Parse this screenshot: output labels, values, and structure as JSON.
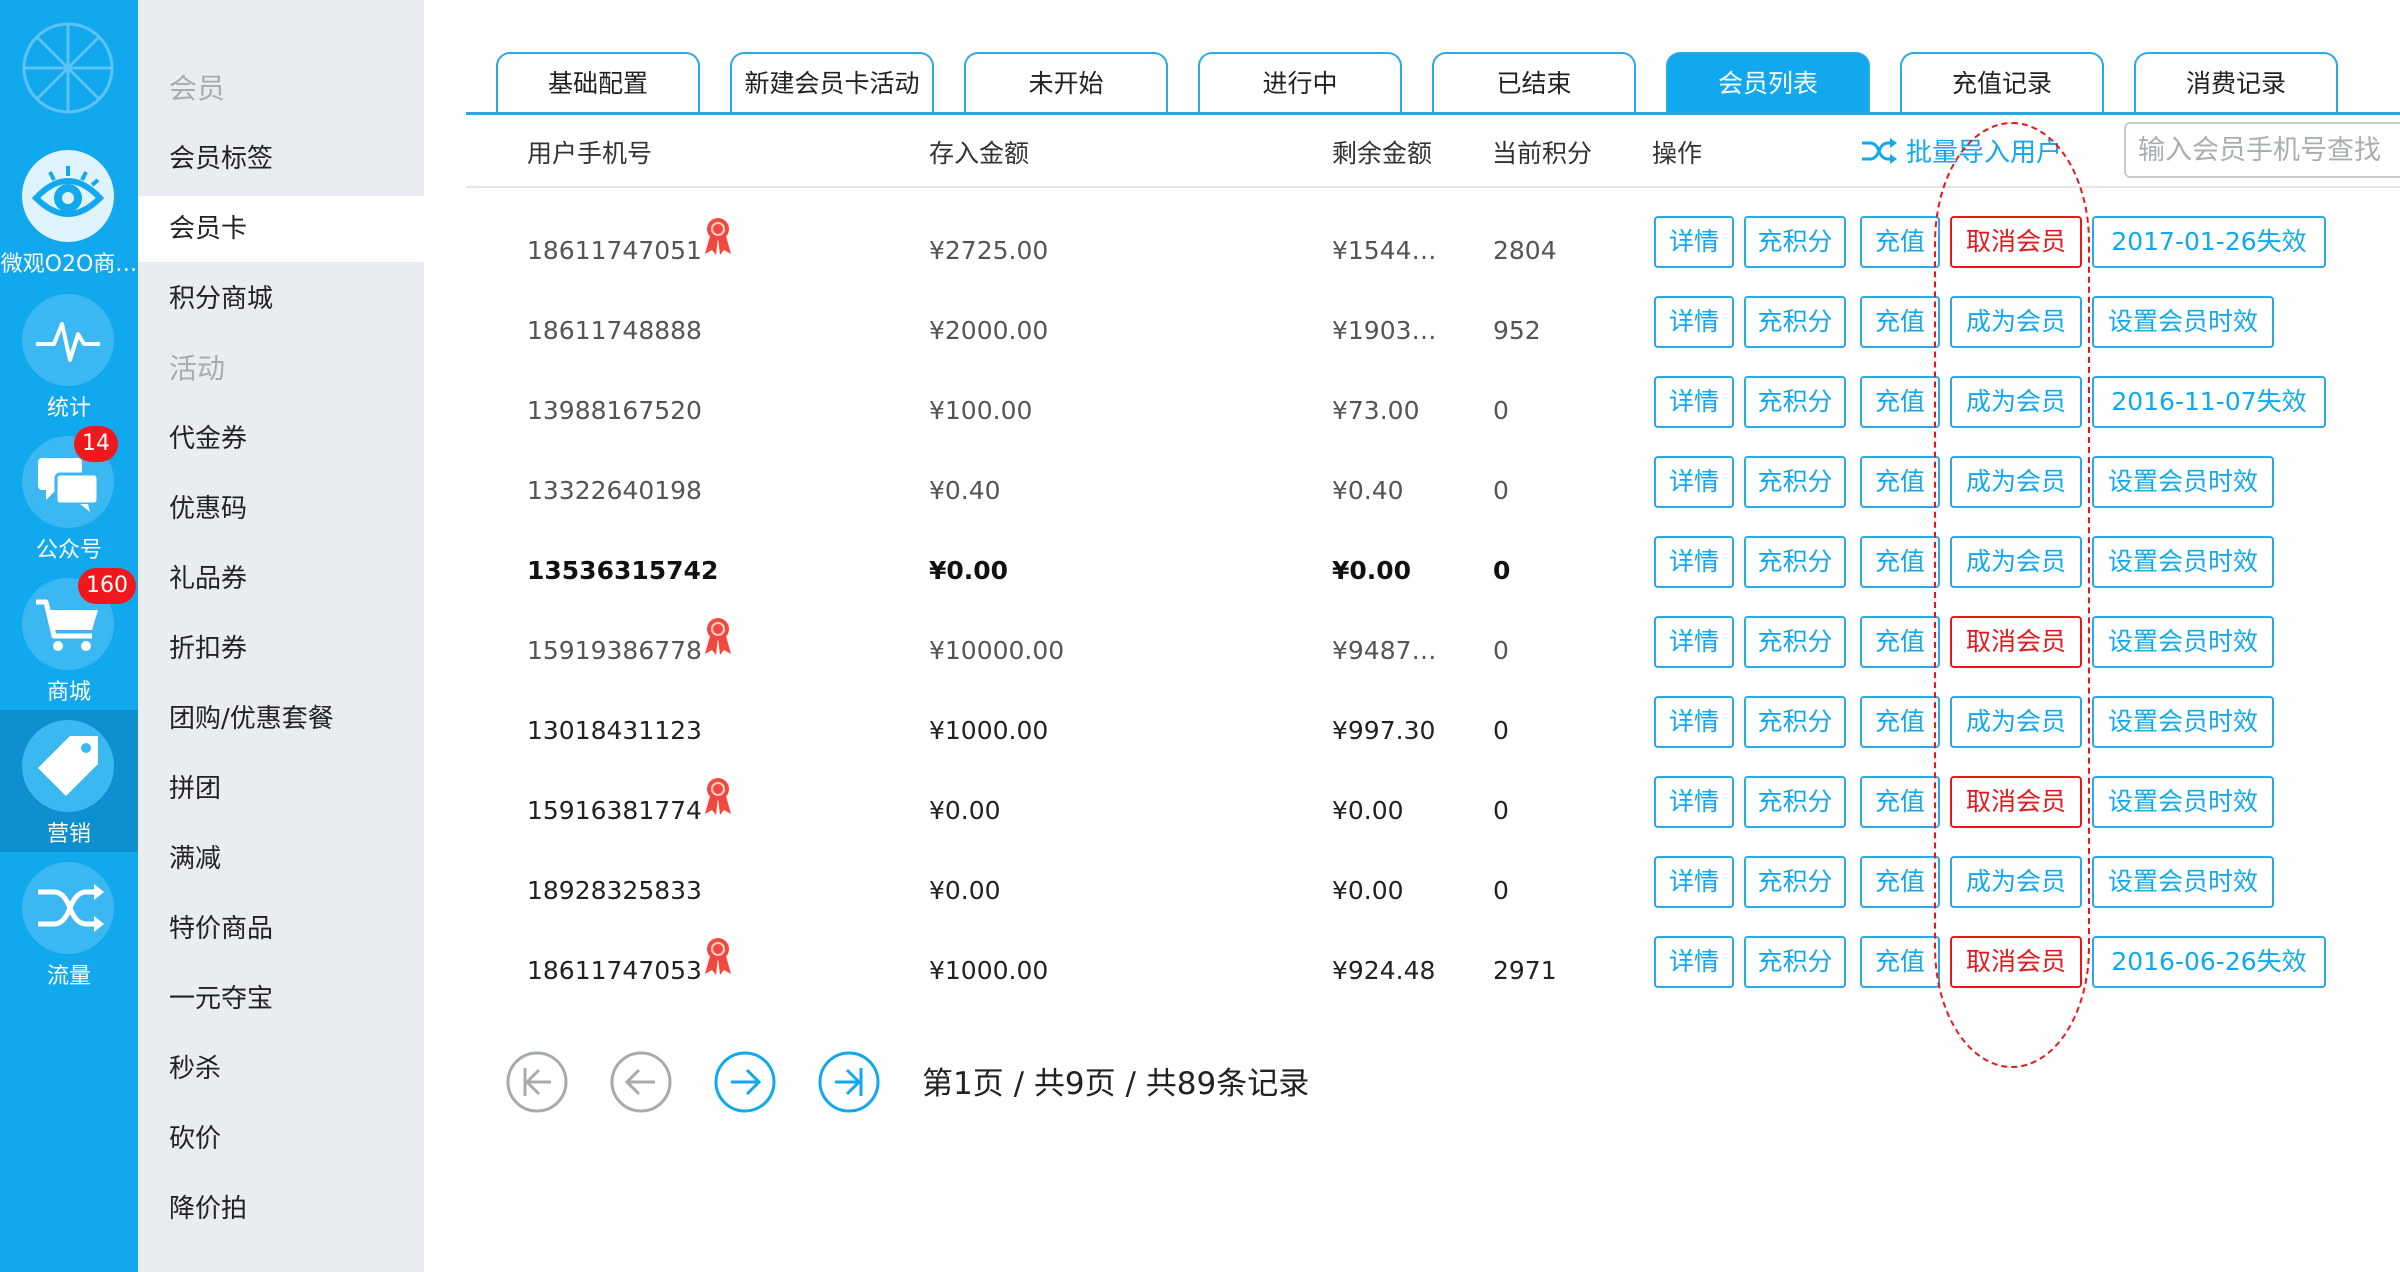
{
  "rail": {
    "items": [
      {
        "key": "shop",
        "label": "微观O2O商…"
      },
      {
        "key": "stats",
        "label": "统计"
      },
      {
        "key": "official",
        "label": "公众号",
        "badge": "14"
      },
      {
        "key": "mall",
        "label": "商城",
        "badge": "160"
      },
      {
        "key": "marketing",
        "label": "营销",
        "active": true
      },
      {
        "key": "traffic",
        "label": "流量"
      }
    ]
  },
  "submenu": {
    "group_member": "会员",
    "member_tag": "会员标签",
    "member_card": "会员卡",
    "points_mall": "积分商城",
    "group_activity": "活动",
    "voucher": "代金券",
    "promo_code": "优惠码",
    "gift_coupon": "礼品券",
    "discount_coupon": "折扣券",
    "group_buy": "团购/优惠套餐",
    "pintuan": "拼团",
    "full_reduction": "满减",
    "special_goods": "特价商品",
    "one_yuan": "一元夺宝",
    "flash_sale": "秒杀",
    "bargain": "砍价",
    "dutch_auction": "降价拍"
  },
  "tabs": [
    "基础配置",
    "新建会员卡活动",
    "未开始",
    "进行中",
    "已结束",
    "会员列表",
    "充值记录",
    "消费记录"
  ],
  "active_tab": "会员列表",
  "table": {
    "headers": {
      "phone": "用户手机号",
      "deposit": "存入金额",
      "balance": "剩余金额",
      "points": "当前积分",
      "actions": "操作"
    },
    "batch_import": "批量导入用户",
    "search_placeholder": "输入会员手机号查找",
    "action_labels": {
      "detail": "详情",
      "add_points": "充积分",
      "recharge": "充值"
    },
    "rows": [
      {
        "phone": "18611747051",
        "medal": true,
        "deposit": "¥2725.00",
        "balance": "¥1544…",
        "points": "2804",
        "member_action": "取消会员",
        "member_red": true,
        "expiry": "2017-01-26失效"
      },
      {
        "phone": "18611748888",
        "medal": false,
        "deposit": "¥2000.00",
        "balance": "¥1903…",
        "points": "952",
        "member_action": "成为会员",
        "member_red": false,
        "expiry": "设置会员时效"
      },
      {
        "phone": "13988167520",
        "medal": false,
        "deposit": "¥100.00",
        "balance": "¥73.00",
        "points": "0",
        "member_action": "成为会员",
        "member_red": false,
        "expiry": "2016-11-07失效"
      },
      {
        "phone": "13322640198",
        "medal": false,
        "deposit": "¥0.40",
        "balance": "¥0.40",
        "points": "0",
        "member_action": "成为会员",
        "member_red": false,
        "expiry": "设置会员时效"
      },
      {
        "phone": "13536315742",
        "medal": false,
        "deposit": "¥0.00",
        "balance": "¥0.00",
        "points": "0",
        "member_action": "成为会员",
        "member_red": false,
        "expiry": "设置会员时效",
        "bold": true
      },
      {
        "phone": "15919386778",
        "medal": true,
        "deposit": "¥10000.00",
        "balance": "¥9487…",
        "points": "0",
        "member_action": "取消会员",
        "member_red": true,
        "expiry": "设置会员时效"
      },
      {
        "phone": "13018431123",
        "medal": false,
        "deposit": "¥1000.00",
        "balance": "¥997.30",
        "points": "0",
        "member_action": "成为会员",
        "member_red": false,
        "expiry": "设置会员时效",
        "dark": true
      },
      {
        "phone": "15916381774",
        "medal": true,
        "deposit": "¥0.00",
        "balance": "¥0.00",
        "points": "0",
        "member_action": "取消会员",
        "member_red": true,
        "expiry": "设置会员时效",
        "dark": true
      },
      {
        "phone": "18928325833",
        "medal": false,
        "deposit": "¥0.00",
        "balance": "¥0.00",
        "points": "0",
        "member_action": "成为会员",
        "member_red": false,
        "expiry": "设置会员时效",
        "dark": true
      },
      {
        "phone": "18611747053",
        "medal": true,
        "deposit": "¥1000.00",
        "balance": "¥924.48",
        "points": "2971",
        "member_action": "取消会员",
        "member_red": true,
        "expiry": "2016-06-26失效",
        "dark": true
      }
    ]
  },
  "pagination": {
    "info": "第1页 / 共9页 / 共89条记录"
  },
  "colors": {
    "primary": "#12a8ee",
    "danger": "#e8161b",
    "badge": "#f0181c",
    "medal": "#f04a3e"
  }
}
